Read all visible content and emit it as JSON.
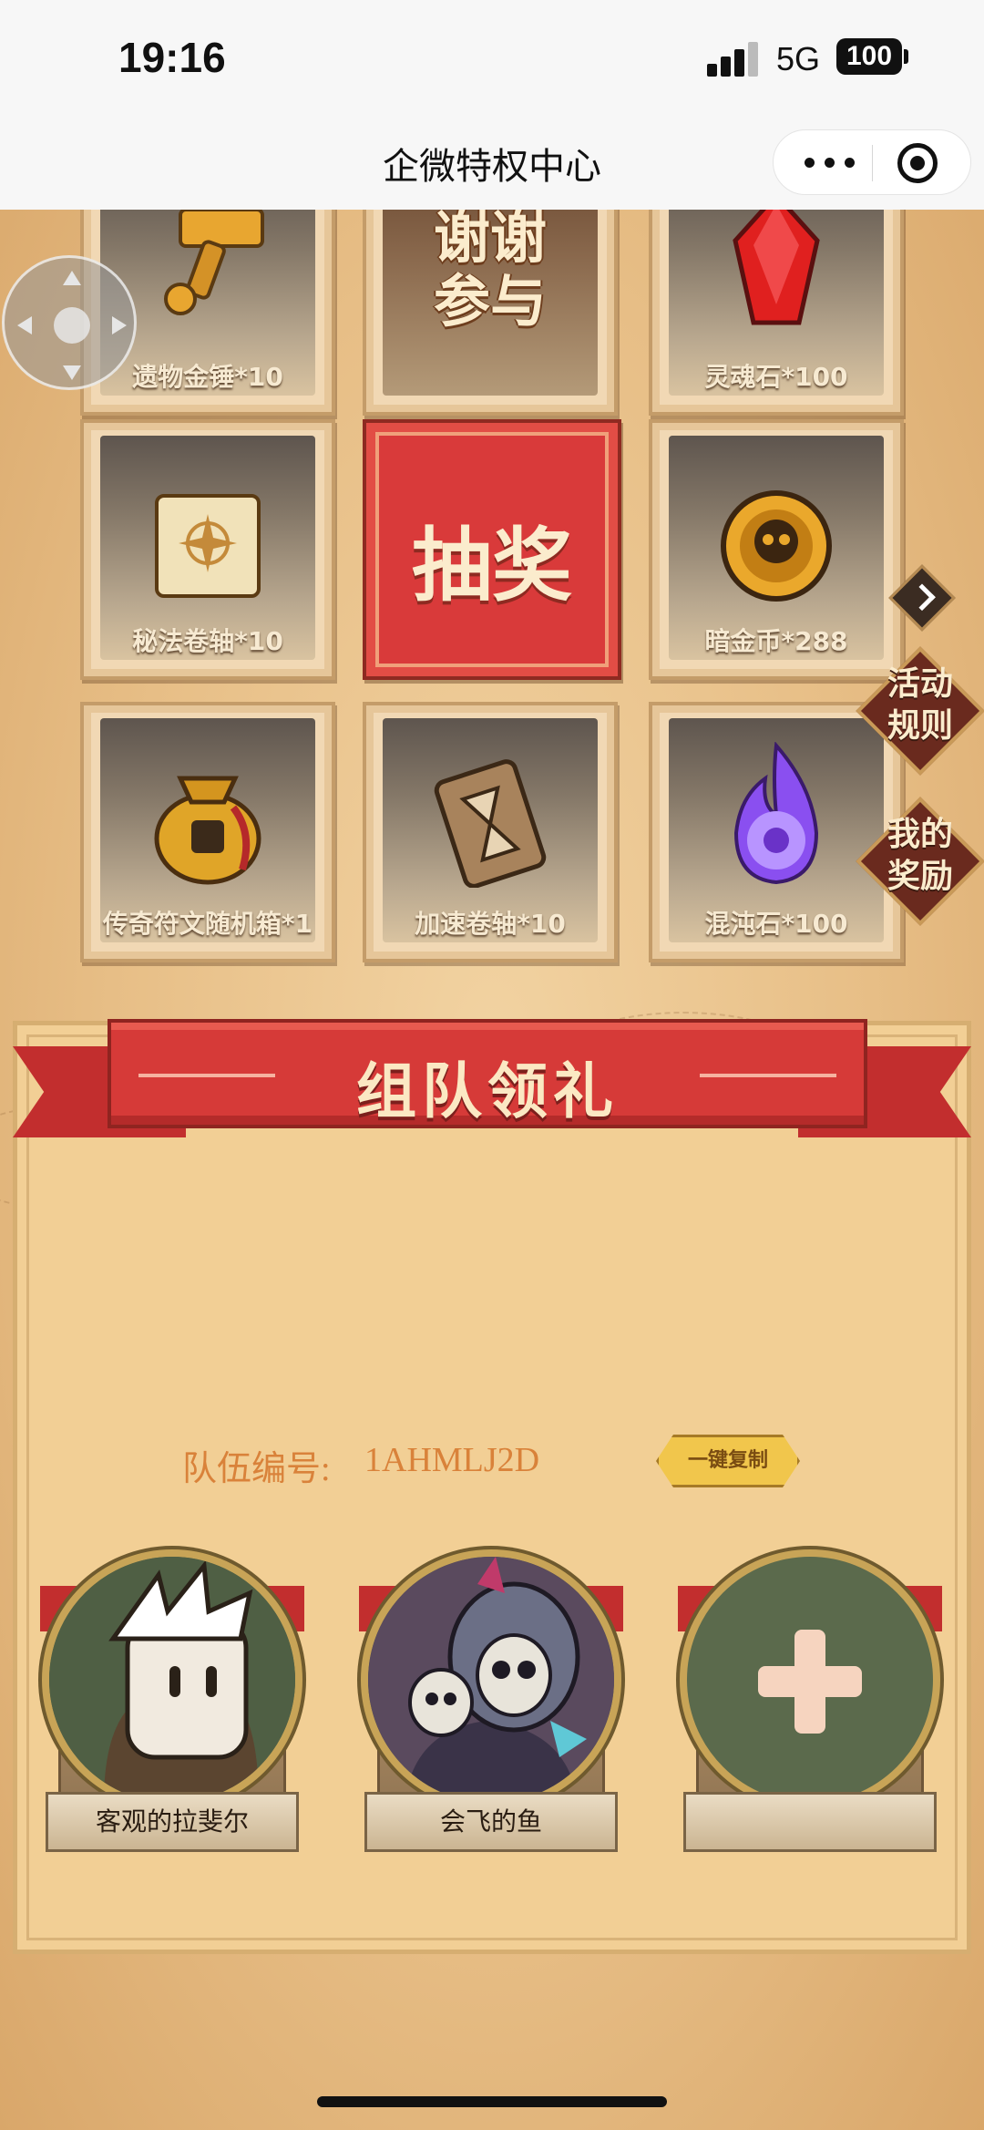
{
  "status_bar": {
    "time": "19:16",
    "network": "5G",
    "battery": "100"
  },
  "nav": {
    "title": "企微特权中心"
  },
  "lottery": {
    "cells": [
      {
        "label": "遗物金锤*10",
        "icon": "golden-hammer-icon"
      },
      {
        "label": "谢谢\n参与",
        "icon": "thanks-text"
      },
      {
        "label": "灵魂石*100",
        "icon": "red-crystal-icon"
      },
      {
        "label": "秘法卷轴*10",
        "icon": "scroll-icon"
      },
      {
        "label": "暗金币*288",
        "icon": "skull-coin-icon"
      },
      {
        "label": "传奇符文随机箱*1",
        "icon": "rune-bag-icon"
      },
      {
        "label": "加速卷轴*10",
        "icon": "hourglass-scroll-icon"
      },
      {
        "label": "混沌石*100",
        "icon": "purple-flame-orb-icon"
      }
    ],
    "draw_label": "抽奖"
  },
  "side": {
    "rules_label": "活动\n规则",
    "rewards_label": "我的\n奖励"
  },
  "team": {
    "title": "组队领礼",
    "id_label": "队伍编号:",
    "id_value": "1AHMLJ2D",
    "copy_label": "一键复制",
    "members": [
      {
        "name": "客观的拉斐尔",
        "avatar": "white-hair-character-avatar"
      },
      {
        "name": "会飞的鱼",
        "avatar": "skull-warrior-avatar"
      },
      {
        "name": "",
        "avatar": "plus-icon"
      }
    ]
  },
  "colors": {
    "accent_red": "#d63a38",
    "parchment": "#f2cf95",
    "id_text": "#d9823a"
  }
}
